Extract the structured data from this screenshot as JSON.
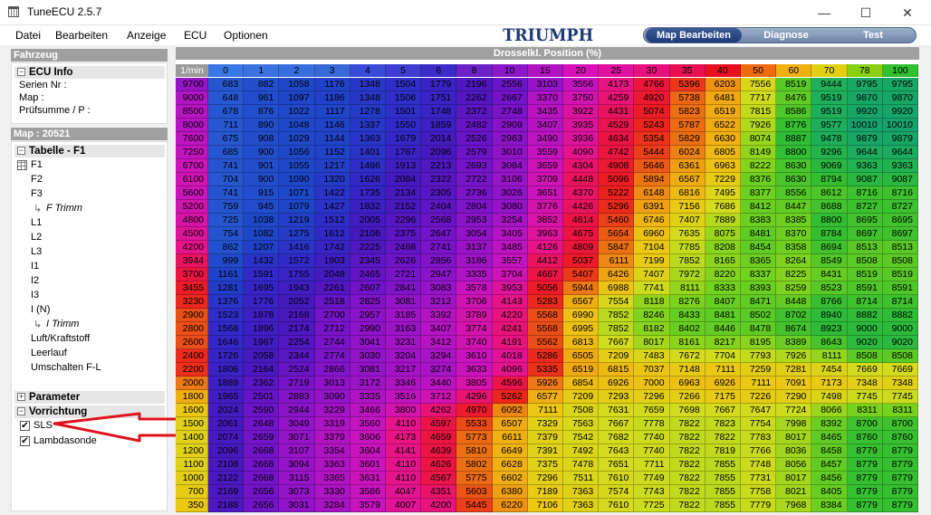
{
  "window": {
    "title": "TuneECU 2.5.7",
    "minimize": "—",
    "maximize": "☐",
    "close": "✕"
  },
  "menu": [
    "Datei",
    "Bearbeiten",
    "Anzeige",
    "ECU",
    "Optionen"
  ],
  "logo": "TRIUMPH",
  "mode_tabs": [
    "Map Bearbeiten",
    "Diagnose",
    "Test"
  ],
  "active_mode": 0,
  "sidebar": {
    "fahrzeug_header": "Fahrzeug",
    "ecu_info": {
      "title": "ECU Info",
      "lines": [
        "Serien Nr :",
        "Map :",
        "Prüfsumme / P :"
      ]
    },
    "map_header": "Map : 20521",
    "tabelle": {
      "title": "Tabelle - F1",
      "items": [
        {
          "label": "F1"
        },
        {
          "label": "F2"
        },
        {
          "label": "F3"
        },
        {
          "label": "F Trimm",
          "sub": true
        },
        {
          "label": "L1"
        },
        {
          "label": "L2"
        },
        {
          "label": "L3"
        },
        {
          "label": "I1"
        },
        {
          "label": "I2"
        },
        {
          "label": "I3"
        },
        {
          "label": "I (N)"
        },
        {
          "label": "I Trimm",
          "sub": true
        },
        {
          "label": "Luft/Kraftstoff"
        },
        {
          "label": "Leerlauf"
        },
        {
          "label": "Umschalten F-L"
        }
      ]
    },
    "parameter": {
      "title": "Parameter"
    },
    "vorrichtung": {
      "title": "Vorrichtung",
      "items": [
        {
          "label": "SLS",
          "checked": true
        },
        {
          "label": "Lambdasonde",
          "checked": true
        }
      ]
    }
  },
  "map": {
    "header": "Drosselkl. Position (%)",
    "corner": "1/min",
    "columns": [
      "0",
      "1",
      "2",
      "3",
      "4",
      "5",
      "6",
      "8",
      "10",
      "15",
      "20",
      "25",
      "30",
      "35",
      "40",
      "50",
      "60",
      "70",
      "78",
      "100"
    ],
    "rows": [
      {
        "rpm": "9700",
        "v": [
          683,
          882,
          1058,
          1176,
          1348,
          1504,
          1779,
          2196,
          2556,
          3103,
          3556,
          4173,
          4766,
          5396,
          6203,
          7556,
          8519,
          9444,
          9795,
          9795
        ]
      },
      {
        "rpm": "9000",
        "v": [
          648,
          961,
          1097,
          1186,
          1348,
          1506,
          1751,
          2262,
          2667,
          3370,
          3750,
          4259,
          4920,
          5738,
          6481,
          7717,
          8476,
          9519,
          9870,
          9870
        ]
      },
      {
        "rpm": "8500",
        "v": [
          678,
          876,
          1022,
          1117,
          1278,
          1501,
          1748,
          2372,
          2748,
          3435,
          3922,
          4431,
          5074,
          5823,
          6519,
          7815,
          8586,
          9519,
          9920,
          9920
        ]
      },
      {
        "rpm": "8000",
        "v": [
          711,
          890,
          1048,
          1146,
          1337,
          1550,
          1859,
          2482,
          2909,
          3407,
          3935,
          4529,
          5243,
          5787,
          6522,
          7926,
          8776,
          9577,
          10010,
          10010
        ]
      },
      {
        "rpm": "7600",
        "v": [
          675,
          908,
          1029,
          1144,
          1363,
          1679,
          2014,
          2526,
          2963,
          3490,
          3936,
          4634,
          5354,
          5829,
          6630,
          8074,
          8887,
          9478,
          9879,
          9879
        ]
      },
      {
        "rpm": "7250",
        "v": [
          685,
          900,
          1056,
          1152,
          1401,
          1767,
          2096,
          2579,
          3010,
          3559,
          4090,
          4742,
          5444,
          6024,
          6805,
          8149,
          8800,
          9296,
          9644,
          9644
        ]
      },
      {
        "rpm": "6700",
        "v": [
          741,
          901,
          1055,
          1217,
          1496,
          1913,
          2213,
          2693,
          3084,
          3659,
          4304,
          4908,
          5646,
          6361,
          6963,
          8222,
          8630,
          9069,
          9363,
          9363
        ]
      },
      {
        "rpm": "6100",
        "v": [
          704,
          900,
          1090,
          1320,
          1626,
          2084,
          2322,
          2722,
          3106,
          3709,
          4448,
          5096,
          5894,
          6567,
          7229,
          8376,
          8630,
          8794,
          9087,
          9087
        ]
      },
      {
        "rpm": "5600",
        "v": [
          741,
          915,
          1071,
          1422,
          1735,
          2134,
          2305,
          2736,
          3026,
          3651,
          4370,
          5222,
          6148,
          6816,
          7495,
          8377,
          8556,
          8612,
          8716,
          8716
        ]
      },
      {
        "rpm": "5200",
        "v": [
          759,
          945,
          1079,
          1427,
          1832,
          2152,
          2404,
          2804,
          3080,
          3776,
          4426,
          5296,
          6391,
          7156,
          7686,
          8412,
          8447,
          8688,
          8727,
          8727
        ]
      },
      {
        "rpm": "4800",
        "v": [
          725,
          1038,
          1219,
          1512,
          2005,
          2296,
          2568,
          2953,
          3254,
          3852,
          4614,
          5460,
          6746,
          7407,
          7889,
          8383,
          8385,
          8800,
          8695,
          8695
        ]
      },
      {
        "rpm": "4500",
        "v": [
          754,
          1082,
          1275,
          1612,
          2106,
          2375,
          2647,
          3054,
          3405,
          3963,
          4675,
          5654,
          6960,
          7635,
          8075,
          8481,
          8370,
          8784,
          8697,
          8697
        ]
      },
      {
        "rpm": "4200",
        "v": [
          862,
          1207,
          1416,
          1742,
          2225,
          2468,
          2741,
          3137,
          3485,
          4126,
          4809,
          5847,
          7104,
          7785,
          8208,
          8454,
          8358,
          8694,
          8513,
          8513
        ]
      },
      {
        "rpm": "3944",
        "v": [
          999,
          1432,
          1572,
          1903,
          2345,
          2626,
          2856,
          3186,
          3557,
          4412,
          5037,
          6111,
          7199,
          7852,
          8165,
          8365,
          8264,
          8549,
          8508,
          8508
        ]
      },
      {
        "rpm": "3700",
        "v": [
          1161,
          1591,
          1755,
          2048,
          2465,
          2721,
          2947,
          3335,
          3704,
          4667,
          5407,
          6426,
          7407,
          7972,
          8220,
          8337,
          8225,
          8431,
          8519,
          8519
        ]
      },
      {
        "rpm": "3455",
        "v": [
          1281,
          1695,
          1943,
          2261,
          2607,
          2841,
          3083,
          3578,
          3953,
          5056,
          5944,
          6988,
          7741,
          8111,
          8333,
          8393,
          8259,
          8523,
          8591,
          8591
        ]
      },
      {
        "rpm": "3230",
        "v": [
          1376,
          1776,
          2052,
          2518,
          2825,
          3081,
          3212,
          3706,
          4143,
          5283,
          6567,
          7554,
          8118,
          8276,
          8407,
          8471,
          8448,
          8766,
          8714,
          8714
        ]
      },
      {
        "rpm": "2900",
        "v": [
          1523,
          1878,
          2168,
          2700,
          2957,
          3185,
          3392,
          3789,
          4220,
          5568,
          6990,
          7852,
          8246,
          8433,
          8481,
          8502,
          8702,
          8940,
          8882,
          8882
        ]
      },
      {
        "rpm": "2800",
        "v": [
          1568,
          1896,
          2174,
          2712,
          2990,
          3163,
          3407,
          3774,
          4241,
          5568,
          6995,
          7852,
          8182,
          8402,
          8446,
          8478,
          8674,
          8923,
          9000,
          9000
        ]
      },
      {
        "rpm": "2600",
        "v": [
          1646,
          1967,
          2254,
          2744,
          3041,
          3231,
          3412,
          3740,
          4191,
          5562,
          6813,
          7667,
          8017,
          8161,
          8217,
          8195,
          8389,
          8643,
          9020,
          9020
        ]
      },
      {
        "rpm": "2400",
        "v": [
          1726,
          2058,
          2344,
          2774,
          3030,
          3204,
          3294,
          3610,
          4018,
          5286,
          6505,
          7209,
          7483,
          7672,
          7704,
          7793,
          7926,
          8111,
          8508,
          8508
        ]
      },
      {
        "rpm": "2200",
        "v": [
          1806,
          2164,
          2524,
          2866,
          3081,
          3217,
          3274,
          3633,
          4096,
          5335,
          6519,
          6815,
          7037,
          7148,
          7111,
          7259,
          7281,
          7454,
          7669,
          7669
        ]
      },
      {
        "rpm": "2000",
        "v": [
          1889,
          2362,
          2719,
          3013,
          3172,
          3346,
          3440,
          3805,
          4596,
          5926,
          6854,
          6926,
          7000,
          6963,
          6926,
          7111,
          7091,
          7173,
          7348,
          7348
        ]
      },
      {
        "rpm": "1800",
        "v": [
          1965,
          2501,
          2883,
          3090,
          3335,
          3516,
          3712,
          4296,
          5262,
          6577,
          7209,
          7293,
          7296,
          7266,
          7175,
          7226,
          7290,
          7498,
          7745,
          7745
        ]
      },
      {
        "rpm": "1600",
        "v": [
          2024,
          2590,
          2944,
          3229,
          3466,
          3800,
          4262,
          4970,
          6092,
          7111,
          7508,
          7631,
          7659,
          7698,
          7667,
          7647,
          7724,
          8066,
          8311,
          8311
        ]
      },
      {
        "rpm": "1500",
        "v": [
          2061,
          2648,
          3049,
          3319,
          3560,
          4110,
          4597,
          5533,
          6507,
          7329,
          7563,
          7667,
          7778,
          7822,
          7823,
          7754,
          7998,
          8392,
          8700,
          8700
        ]
      },
      {
        "rpm": "1400",
        "v": [
          2074,
          2659,
          3071,
          3379,
          3606,
          4173,
          4659,
          5773,
          6611,
          7379,
          7542,
          7682,
          7740,
          7822,
          7822,
          7783,
          8017,
          8465,
          8760,
          8760
        ]
      },
      {
        "rpm": "1200",
        "v": [
          2096,
          2668,
          3107,
          3354,
          3604,
          4141,
          4639,
          5810,
          6649,
          7391,
          7492,
          7643,
          7740,
          7822,
          7819,
          7766,
          8036,
          8458,
          8779,
          8779
        ]
      },
      {
        "rpm": "1100",
        "v": [
          2108,
          2668,
          3094,
          3363,
          3601,
          4110,
          4626,
          5802,
          6628,
          7375,
          7478,
          7651,
          7711,
          7822,
          7855,
          7748,
          8056,
          8457,
          8779,
          8779
        ]
      },
      {
        "rpm": "1000",
        "v": [
          2122,
          2668,
          3115,
          3365,
          3631,
          4110,
          4567,
          5775,
          6602,
          7296,
          7511,
          7610,
          7749,
          7822,
          7855,
          7731,
          8017,
          8456,
          8779,
          8779
        ]
      },
      {
        "rpm": "700",
        "v": [
          2169,
          2656,
          3073,
          3330,
          3586,
          4047,
          4351,
          5603,
          6380,
          7189,
          7363,
          7574,
          7743,
          7822,
          7855,
          7758,
          8021,
          8405,
          8779,
          8779
        ]
      },
      {
        "rpm": "350",
        "v": [
          2188,
          2656,
          3031,
          3284,
          3579,
          4007,
          4200,
          5445,
          6220,
          7106,
          7363,
          7610,
          7725,
          7822,
          7855,
          7779,
          7968,
          8384,
          8779,
          8779
        ]
      }
    ]
  },
  "colors": {
    "title_bar": "#ffffff",
    "panel_header": "#a0a0a0",
    "annotation_arrow": "#e0121b",
    "col_header_colors": [
      "#3b78e6",
      "#3a73e0",
      "#396ede",
      "#3769d8",
      "#3a4bd8",
      "#3d3dd1",
      "#3b2bc8",
      "#6c22c8",
      "#8a18c6",
      "#b014c0",
      "#d710b8",
      "#e010a0",
      "#e8107c",
      "#e81050",
      "#e81020",
      "#f06a10",
      "#f0b010",
      "#e0d010",
      "#8ad010",
      "#30c030"
    ]
  }
}
